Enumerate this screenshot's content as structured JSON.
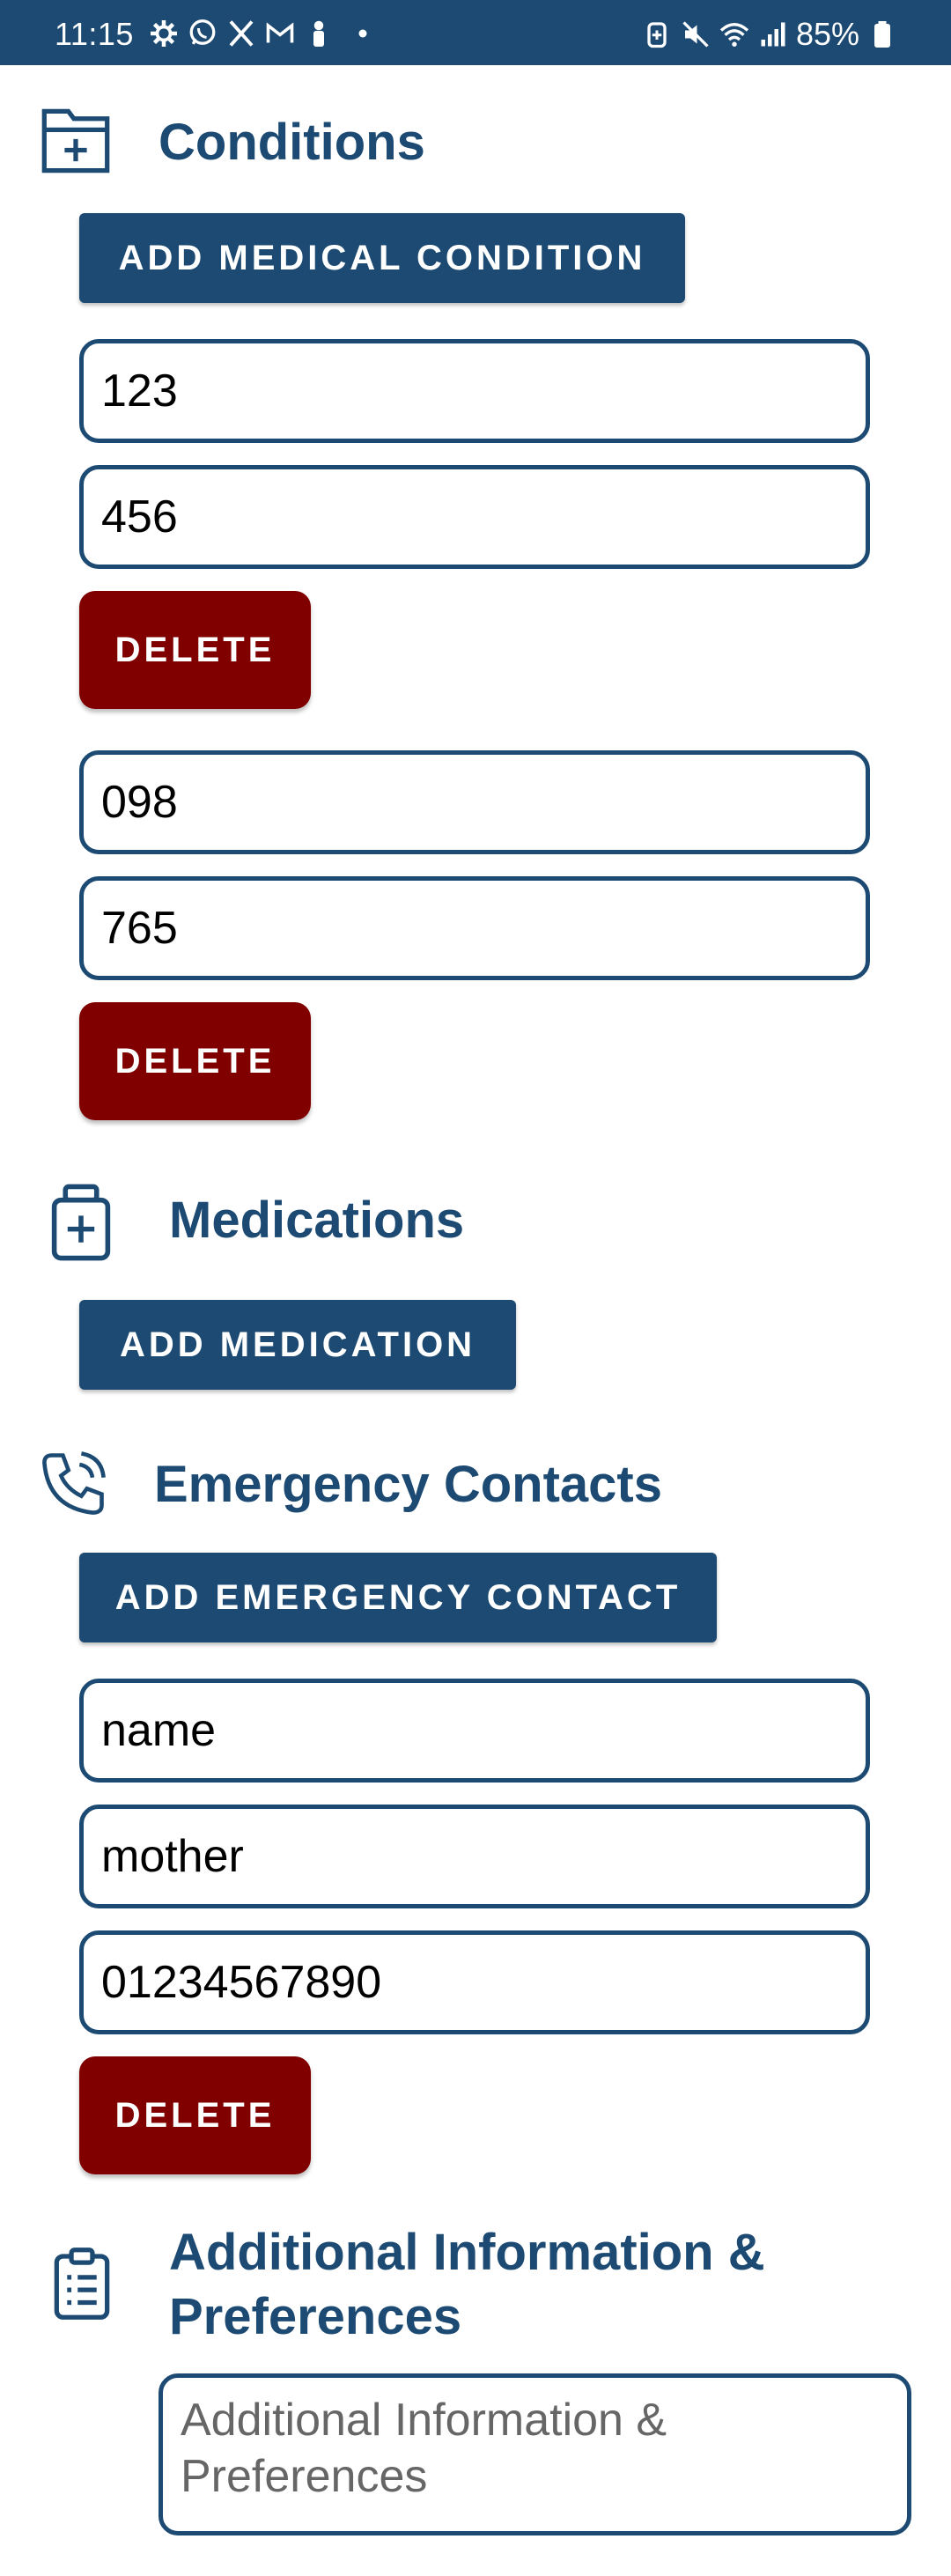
{
  "status_bar": {
    "time": "11:15",
    "battery": "85%"
  },
  "conditions": {
    "title": "Conditions",
    "add_label": "ADD MEDICAL CONDITION",
    "entries": [
      {
        "name": "123",
        "detail": "456",
        "delete_label": "DELETE"
      },
      {
        "name": "098",
        "detail": "765",
        "delete_label": "DELETE"
      }
    ]
  },
  "medications": {
    "title": "Medications",
    "add_label": "ADD MEDICATION"
  },
  "emergency_contacts": {
    "title": "Emergency Contacts",
    "add_label": "ADD EMERGENCY CONTACT",
    "entries": [
      {
        "name": "name",
        "relation": "mother",
        "phone": "01234567890",
        "delete_label": "DELETE"
      }
    ]
  },
  "additional_info": {
    "title_line1": "Additional Information &",
    "title_line2": "Preferences",
    "placeholder_line1": "Additional Information &",
    "placeholder_line2": "Preferences"
  },
  "colors": {
    "primary": "#1c4a72",
    "danger": "#800000"
  }
}
